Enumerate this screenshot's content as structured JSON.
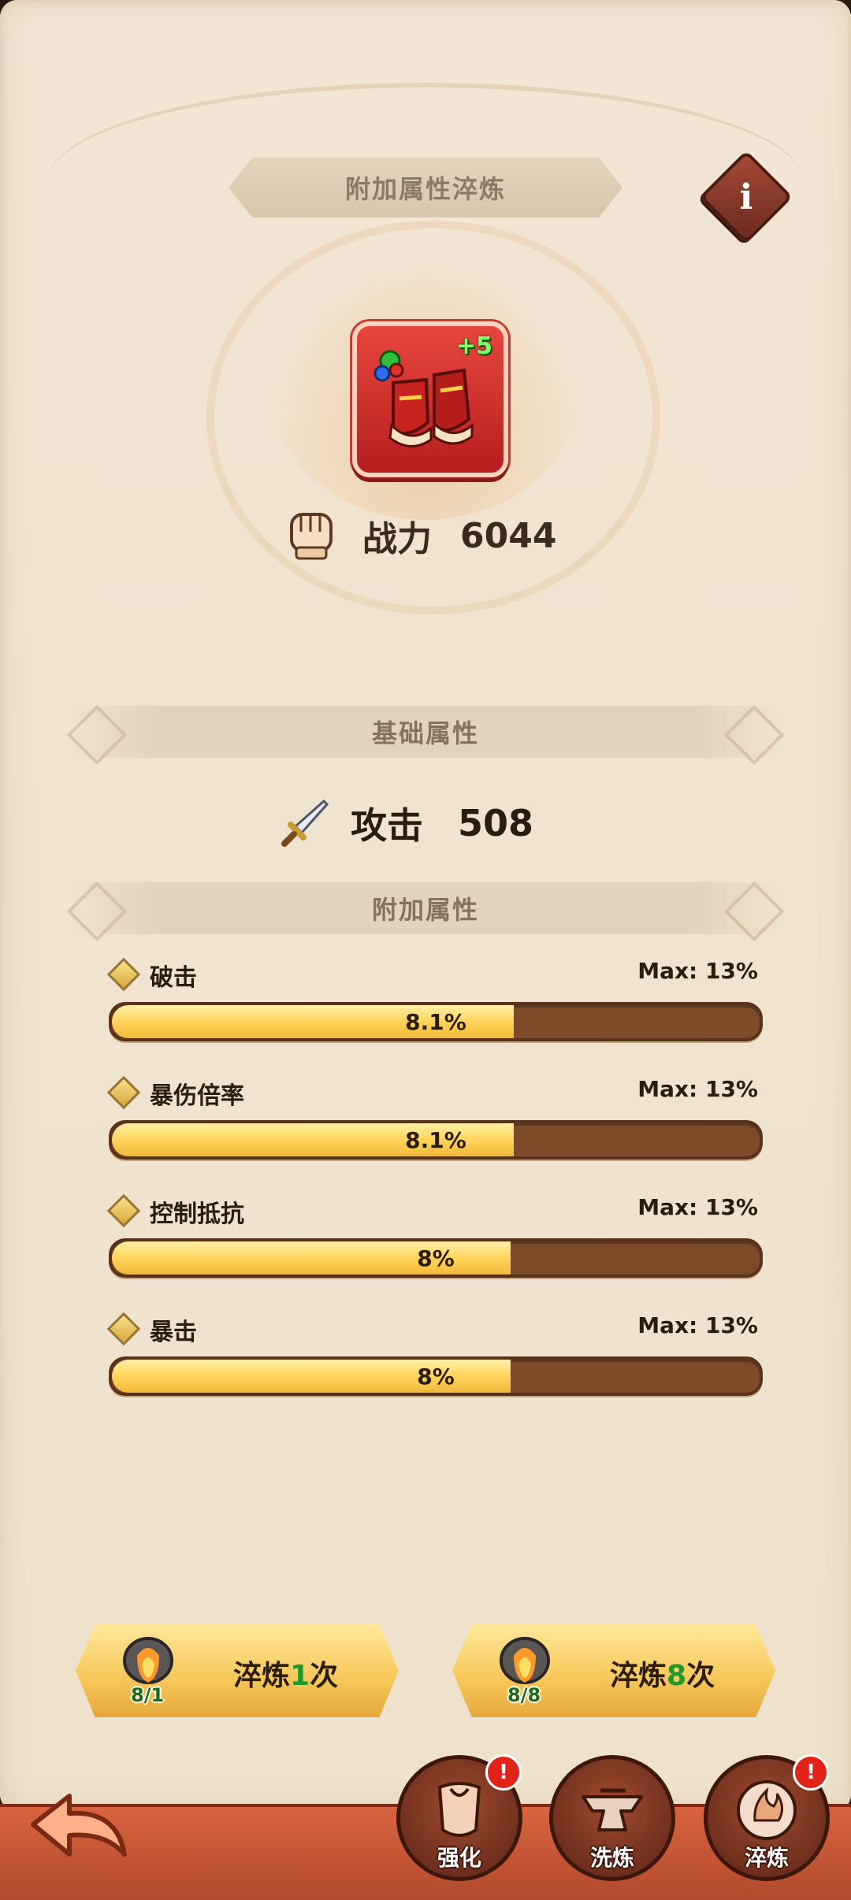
{
  "header": {
    "title": "附加属性淬炼",
    "info_icon": "info-icon"
  },
  "equipment": {
    "level": "+5",
    "icon": "red-boots-icon"
  },
  "power": {
    "label": "战力",
    "value": "6044",
    "icon": "fist-icon"
  },
  "base_section": {
    "title": "基础属性"
  },
  "attack": {
    "label": "攻击",
    "value": "508",
    "icon": "sword-icon"
  },
  "extra_section": {
    "title": "附加属性"
  },
  "stats": [
    {
      "name": "破击",
      "max": "Max: 13%",
      "value": "8.1%",
      "fill": 0.62
    },
    {
      "name": "暴伤倍率",
      "max": "Max: 13%",
      "value": "8.1%",
      "fill": 0.62
    },
    {
      "name": "控制抵抗",
      "max": "Max: 13%",
      "value": "8%",
      "fill": 0.615
    },
    {
      "name": "暴击",
      "max": "Max: 13%",
      "value": "8%",
      "fill": 0.615
    }
  ],
  "refine_buttons": [
    {
      "count": "8/1",
      "label_prefix": "淬炼",
      "label_num": "1",
      "label_suffix": "次"
    },
    {
      "count": "8/8",
      "label_prefix": "淬炼",
      "label_num": "8",
      "label_suffix": "次"
    }
  ],
  "nav": [
    {
      "label": "强化",
      "icon": "armor-icon",
      "badge": "!"
    },
    {
      "label": "洗炼",
      "icon": "anvil-icon",
      "badge": ""
    },
    {
      "label": "淬炼",
      "icon": "fire-emblem-icon",
      "badge": "!"
    }
  ],
  "colors": {
    "accent": "#f6c758",
    "bar_bg": "#7d4a2a",
    "nav_bg": "#b1492c"
  }
}
